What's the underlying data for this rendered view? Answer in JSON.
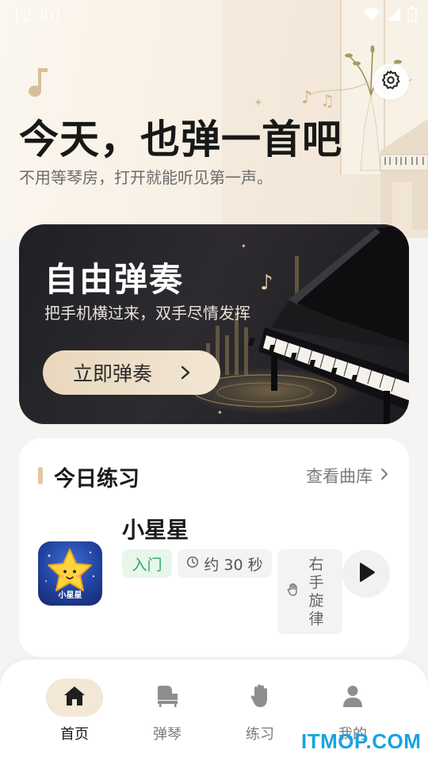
{
  "status_bar": {
    "time": "12:40"
  },
  "hero": {
    "title": "今天，也弹一首吧",
    "subtitle": "不用等琴房，打开就能听见第一声。"
  },
  "free_play": {
    "title": "自由弹奏",
    "subtitle": "把手机横过来，双手尽情发挥",
    "button_label": "立即弹奏"
  },
  "practice": {
    "section_title": "今日练习",
    "library_link": "查看曲库",
    "song": {
      "title": "小星星",
      "art_label": "小星星",
      "level_tag": "入门",
      "duration_tag": "约 30 秒",
      "hand_tag": "右手旋律"
    }
  },
  "bottom_nav": {
    "items": [
      {
        "label": "首页",
        "icon": "home-icon",
        "active": true
      },
      {
        "label": "弹琴",
        "icon": "piano-icon",
        "active": false
      },
      {
        "label": "练习",
        "icon": "hand-icon",
        "active": false
      },
      {
        "label": "我的",
        "icon": "user-icon",
        "active": false
      }
    ]
  },
  "watermark": "ITMOP.COM",
  "colors": {
    "accent_gold": "#e2c89e",
    "tag_green": "#35a56a",
    "card_dark": "#202024",
    "watermark_blue": "#19a3e0"
  }
}
